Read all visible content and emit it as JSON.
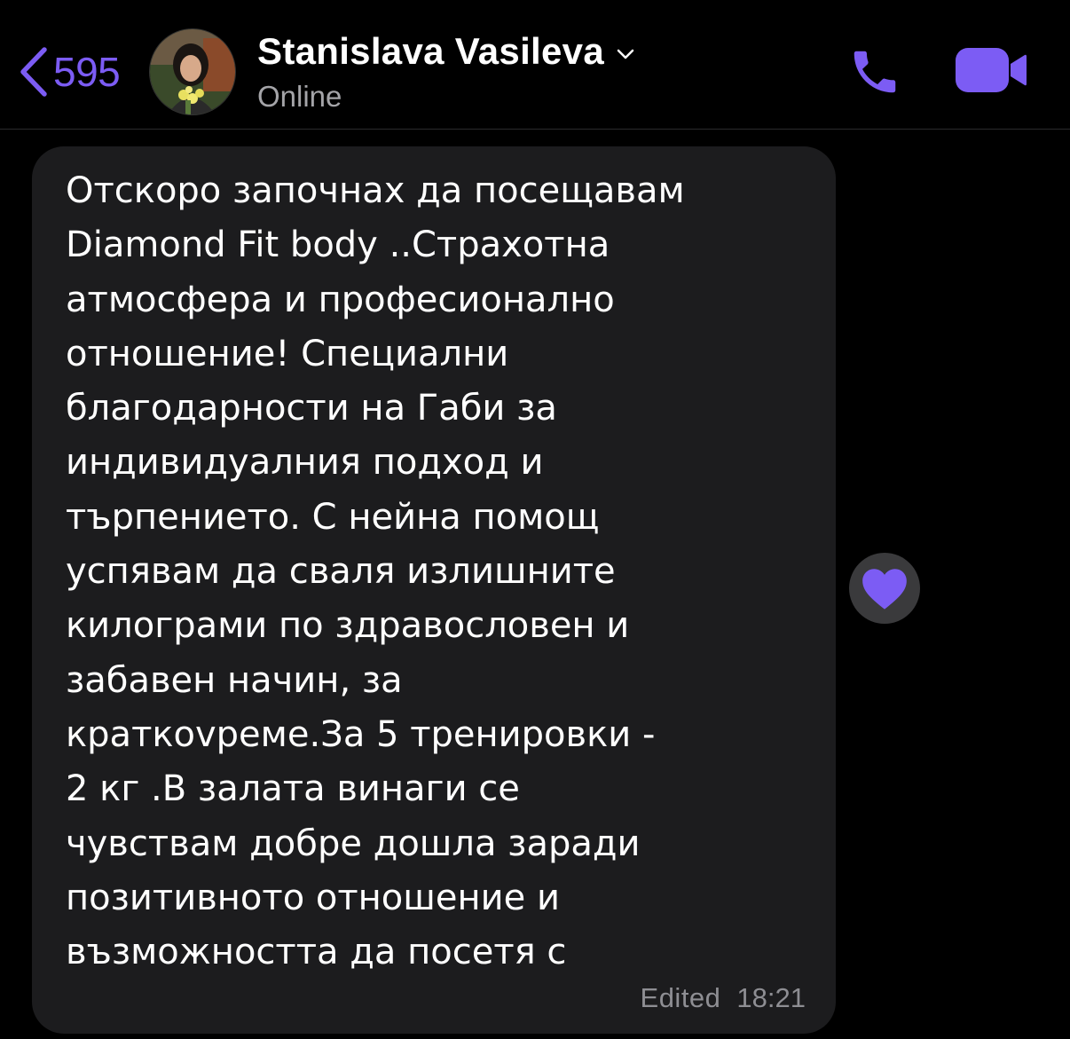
{
  "header": {
    "back_count": "595",
    "contact_name": "Stanislava Vasileva",
    "status": "Online",
    "icons": {
      "back": "chevron-left-icon",
      "expand": "chevron-down-icon",
      "call": "phone-icon",
      "video": "video-camera-icon",
      "avatar": "contact-avatar"
    }
  },
  "message": {
    "text": "Отскоро започнах да посещавам\nDiamond Fit body ..Страхотна\nатмосфера и професионално\nотношение! Специални\nблагодарности на Габи за\nиндивидуалния подход и\nтърпението. С нейна помощ\nуспявам да сваля излишните\nкилограми по здравословен и\nзабавен начин, за\nкраткovреме.За 5 тренировки -\n2 кг .В залата винаги се\nчувствам добре дошла заради\nпозитивното отношение и\nвъзможността да посетя с",
    "edited_label": "Edited",
    "time": "18:21",
    "reaction": "heart-icon"
  },
  "colors": {
    "accent": "#7c5cf4",
    "bubble": "#1c1c1e",
    "background": "#000000",
    "meta_text": "#8e8e93",
    "reaction_bg": "#3a3a3c"
  }
}
